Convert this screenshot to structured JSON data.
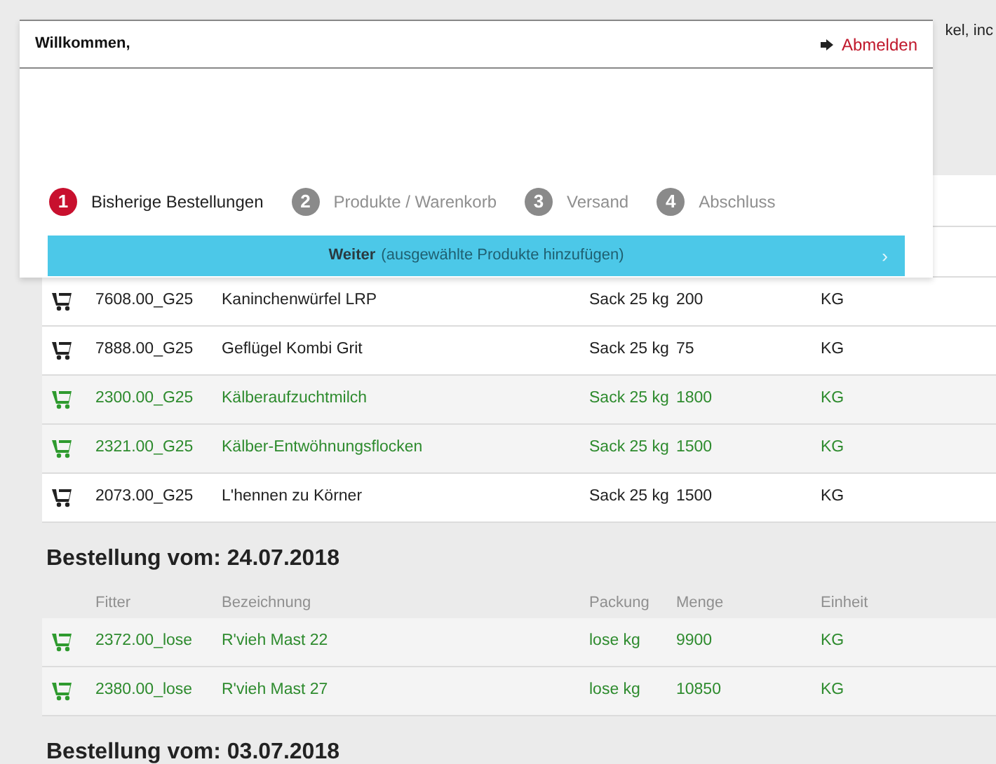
{
  "background_text": "kel, inc",
  "popup": {
    "greeting": "Willkommen,",
    "logout": "Abmelden",
    "steps": [
      {
        "number": "1",
        "label": "Bisherige Bestellungen",
        "selected": true
      },
      {
        "number": "2",
        "label": "Produkte / Warenkorb",
        "selected": false
      },
      {
        "number": "3",
        "label": "Versand",
        "selected": false
      },
      {
        "number": "4",
        "label": "Abschluss",
        "selected": false
      }
    ],
    "continue_bar": {
      "label": "Weiter",
      "hint": "(ausgewählte Produkte hinzufügen)",
      "arrow": "›"
    }
  },
  "orders": [
    {
      "rows": [
        {
          "fitter": "7608.00_G25",
          "name": "Kaninchenwürfel LRP",
          "packing": "Sack 25 kg",
          "amount": "200",
          "unit": "KG",
          "selected": false
        },
        {
          "fitter": "7888.00_G25",
          "name": "Geflügel Kombi Grit",
          "packing": "Sack 25 kg",
          "amount": "75",
          "unit": "KG",
          "selected": false
        },
        {
          "fitter": "2300.00_G25",
          "name": "Kälberaufzuchtmilch",
          "packing": "Sack 25 kg",
          "amount": "1800",
          "unit": "KG",
          "selected": true
        },
        {
          "fitter": "2321.00_G25",
          "name": "Kälber-Entwöhnungsflocken",
          "packing": "Sack 25 kg",
          "amount": "1500",
          "unit": "KG",
          "selected": true
        },
        {
          "fitter": "2073.00_G25",
          "name": "L'hennen zu Körner",
          "packing": "Sack 25 kg",
          "amount": "1500",
          "unit": "KG",
          "selected": false
        }
      ]
    },
    {
      "title": "Bestellung vom: 24.07.2018",
      "columns": [
        "Fitter",
        "Bezeichnung",
        "Packung",
        "Menge",
        "Einheit"
      ],
      "rows": [
        {
          "fitter": "2372.00_lose",
          "name": "R'vieh Mast 22",
          "packing": "lose kg",
          "amount": "9900",
          "unit": "KG",
          "selected": true
        },
        {
          "fitter": "2380.00_lose",
          "name": "R'vieh Mast 27",
          "packing": "lose kg",
          "amount": "10850",
          "unit": "KG",
          "selected": true
        }
      ]
    },
    {
      "title": "Bestellung vom: 03.07.2018"
    }
  ]
}
